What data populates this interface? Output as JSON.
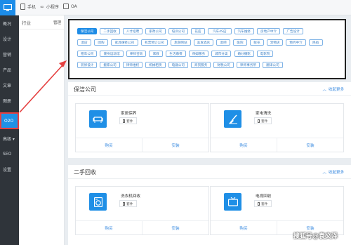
{
  "topbar": {
    "items": [
      {
        "label": "手机",
        "icon": "phone-icon"
      },
      {
        "label": "小程序",
        "icon": "miniprogram-icon"
      },
      {
        "label": "OA",
        "icon": "calendar-icon"
      }
    ]
  },
  "sidebar": {
    "items": [
      "概况",
      "设计",
      "营销",
      "产品",
      "文章",
      "图册",
      "O2O",
      "高级 ▾",
      "SEO",
      "设置"
    ],
    "active": "O2O"
  },
  "subnav": {
    "label": "行业",
    "manage": "管理"
  },
  "tags": [
    "保洁公司",
    "二手回收",
    "人才招聘",
    "家政公司",
    "培训公司",
    "花店",
    "汽车4S店",
    "汽车维修",
    "房地产中介",
    "广告设计",
    "酒店",
    "团购",
    "家具维修公司",
    "机票预订公司",
    "旅游网站",
    "美发酒店",
    "酒吧",
    "医院",
    "鲜花",
    "宠物店",
    "预约中介",
    "民宿",
    "租车公司",
    "健身运动馆",
    "律师咨询",
    "家教",
    "生活缴费",
    "保姆服务",
    "城市分类",
    "婚纱摄影",
    "电影院",
    "装修设计",
    "搬家公司",
    "律师维权",
    "机械租赁",
    "电器公司",
    "商贸服务",
    "财税公司",
    "律师事务所",
    "翻译公司"
  ],
  "sections": [
    {
      "title": "保洁公司",
      "collapse_label": "收起更多",
      "cards": [
        {
          "name": "家居保养",
          "chip": "套件",
          "icon": "sofa-icon",
          "buy": "购买",
          "install": "安装"
        },
        {
          "name": "家电清洗",
          "chip": "套件",
          "icon": "cleaning-brush-icon",
          "buy": "购买",
          "install": "安装"
        }
      ]
    },
    {
      "title": "二手回收",
      "collapse_label": "收起更多",
      "cards": [
        {
          "name": "洗衣机回收",
          "chip": "套件",
          "icon": "washing-machine-icon",
          "buy": "购买",
          "install": "安装"
        },
        {
          "name": "电视回收",
          "chip": "套件",
          "icon": "tv-icon",
          "buy": "购买",
          "install": "安装"
        }
      ]
    }
  ],
  "watermark": "搜狐号@袁文泽",
  "colors": {
    "accent": "#1e8ce6",
    "sidebar": "#2f343a",
    "highlight": "#e54040"
  }
}
